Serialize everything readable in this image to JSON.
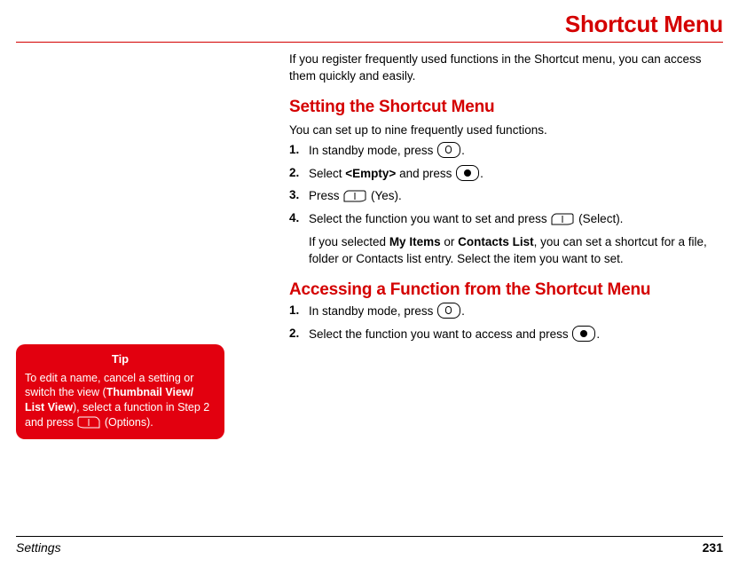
{
  "header": {
    "title": "Shortcut Menu"
  },
  "intro": "If you register frequently used functions in the Shortcut menu, you can access them quickly and easily.",
  "section1": {
    "title": "Setting the Shortcut Menu",
    "sub": "You can set up to nine frequently used functions.",
    "steps": {
      "s1a": "In standby mode, press ",
      "s1b": ".",
      "s2a": "Select ",
      "s2b": "<Empty>",
      "s2c": " and press ",
      "s2d": ".",
      "s3a": "Press ",
      "s3b": " (Yes).",
      "s4a": "Select the function you want to set and press ",
      "s4b": " (Select)."
    },
    "note_a": "If you selected ",
    "note_b": "My Items",
    "note_c": " or ",
    "note_d": "Contacts List",
    "note_e": ", you can set a shortcut for a file, folder or Contacts list entry. Select the item you want to set."
  },
  "section2": {
    "title": "Accessing a Function from the Shortcut Menu",
    "steps": {
      "s1a": "In standby mode, press ",
      "s1b": ".",
      "s2a": "Select the function you want to access and press ",
      "s2b": "."
    }
  },
  "tip": {
    "head": "Tip",
    "a": "To edit a name, cancel a setting or switch the view (",
    "b": "Thumbnail View/ List View",
    "c": "), select a function in Step 2 and press ",
    "d": " (Options)."
  },
  "footer": {
    "left": "Settings",
    "right": "231"
  }
}
